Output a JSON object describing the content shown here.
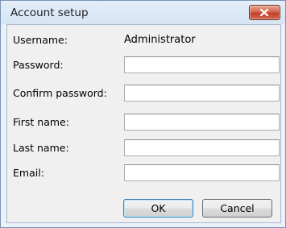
{
  "window": {
    "title": "Account setup"
  },
  "form": {
    "username_label": "Username:",
    "username_value": "Administrator",
    "password_label": "Password:",
    "password_value": "",
    "confirm_password_label": "Confirm password:",
    "confirm_password_value": "",
    "first_name_label": "First name:",
    "first_name_value": "",
    "last_name_label": "Last name:",
    "last_name_value": "",
    "email_label": "Email:",
    "email_value": ""
  },
  "buttons": {
    "ok_label": "OK",
    "cancel_label": "Cancel"
  },
  "icons": {
    "close": "close-icon"
  },
  "colors": {
    "titlebar": "#dce8f6",
    "close_button": "#c94a34",
    "dialog_background": "#f0f0f0"
  }
}
